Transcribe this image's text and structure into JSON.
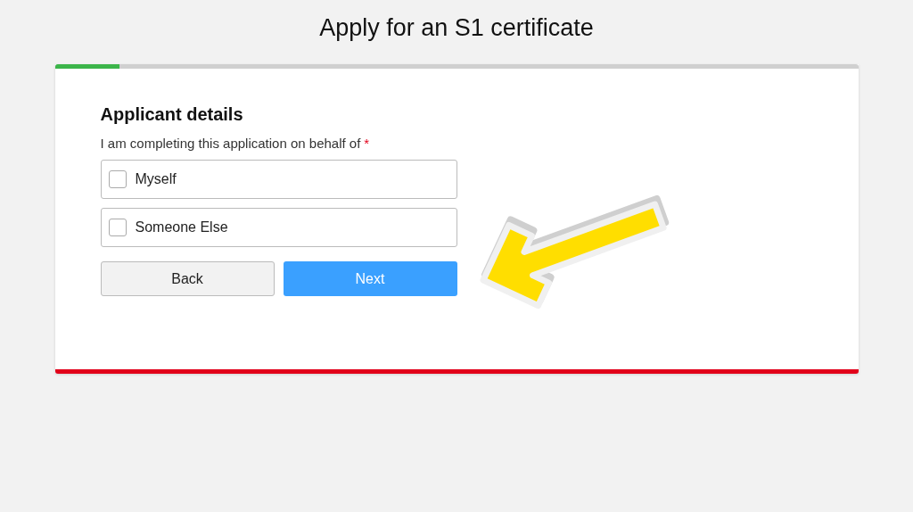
{
  "page_title": "Apply for an S1 certificate",
  "progress": {
    "level": 0.08
  },
  "section_title": "Applicant details",
  "question": {
    "label": "I am completing this application on behalf of",
    "required_mark": "*"
  },
  "options": [
    {
      "label": "Myself",
      "checked": false
    },
    {
      "label": "Someone Else",
      "checked": false
    }
  ],
  "buttons": [
    {
      "label": "Back",
      "kind": "secondary"
    },
    {
      "label": "Next",
      "kind": "primary"
    }
  ]
}
